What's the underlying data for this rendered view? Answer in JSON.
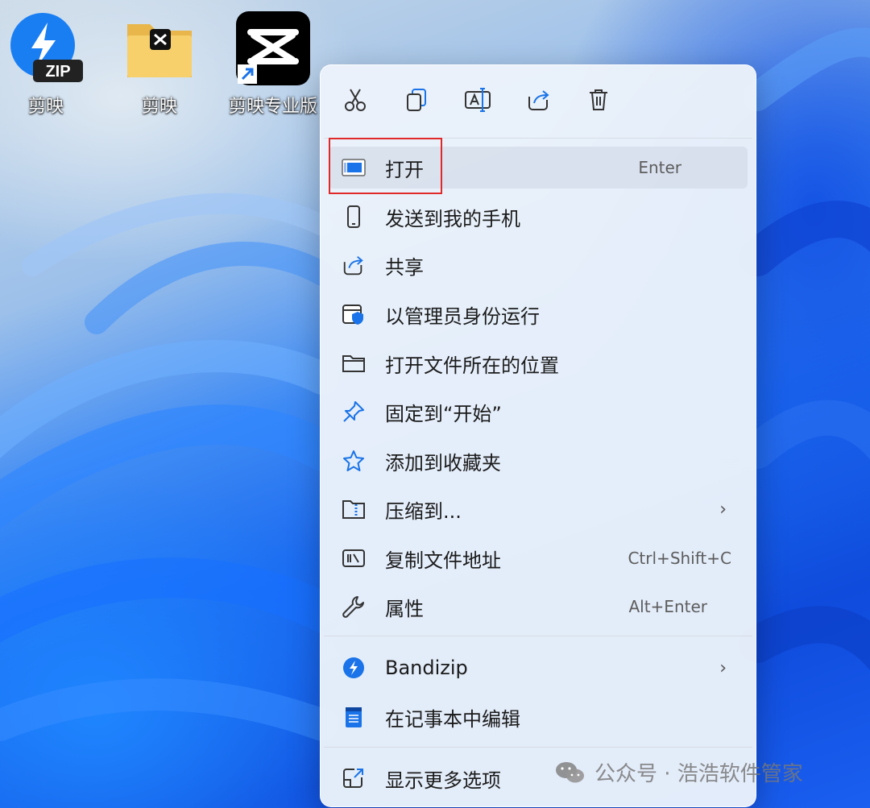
{
  "desktop": {
    "icons": [
      {
        "label": "剪映",
        "badge": "ZIP"
      },
      {
        "label": "剪映"
      },
      {
        "label": "剪映专业版"
      }
    ]
  },
  "context_menu": {
    "toolbar": [
      {
        "icon": "cut-icon"
      },
      {
        "icon": "copy-icon"
      },
      {
        "icon": "rename-icon"
      },
      {
        "icon": "share-icon"
      },
      {
        "icon": "delete-icon"
      }
    ],
    "items": [
      {
        "label": "打开",
        "shortcut": "Enter",
        "icon": "open-window-icon",
        "highlighted": true
      },
      {
        "label": "发送到我的手机",
        "icon": "phone-icon"
      },
      {
        "label": "共享",
        "icon": "share-icon"
      },
      {
        "label": "以管理员身份运行",
        "icon": "admin-shield-icon"
      },
      {
        "label": "打开文件所在的位置",
        "icon": "folder-icon"
      },
      {
        "label": "固定到“开始”",
        "icon": "pin-icon"
      },
      {
        "label": "添加到收藏夹",
        "icon": "star-icon"
      },
      {
        "label": "压缩到...",
        "icon": "zip-folder-icon",
        "submenu": true
      },
      {
        "label": "复制文件地址",
        "shortcut": "Ctrl+Shift+C",
        "icon": "copy-path-icon"
      },
      {
        "label": "属性",
        "shortcut": "Alt+Enter",
        "icon": "wrench-icon"
      },
      {
        "label": "Bandizip",
        "icon": "bandizip-icon",
        "submenu": true
      },
      {
        "label": "在记事本中编辑",
        "icon": "notepad-icon"
      },
      {
        "label": "显示更多选项",
        "icon": "more-options-icon"
      }
    ],
    "chevron": "›"
  },
  "watermark": {
    "text": "公众号 · 浩浩软件管家"
  },
  "colors": {
    "accent": "#1a73e8",
    "highlight_border": "#e02a2a"
  }
}
